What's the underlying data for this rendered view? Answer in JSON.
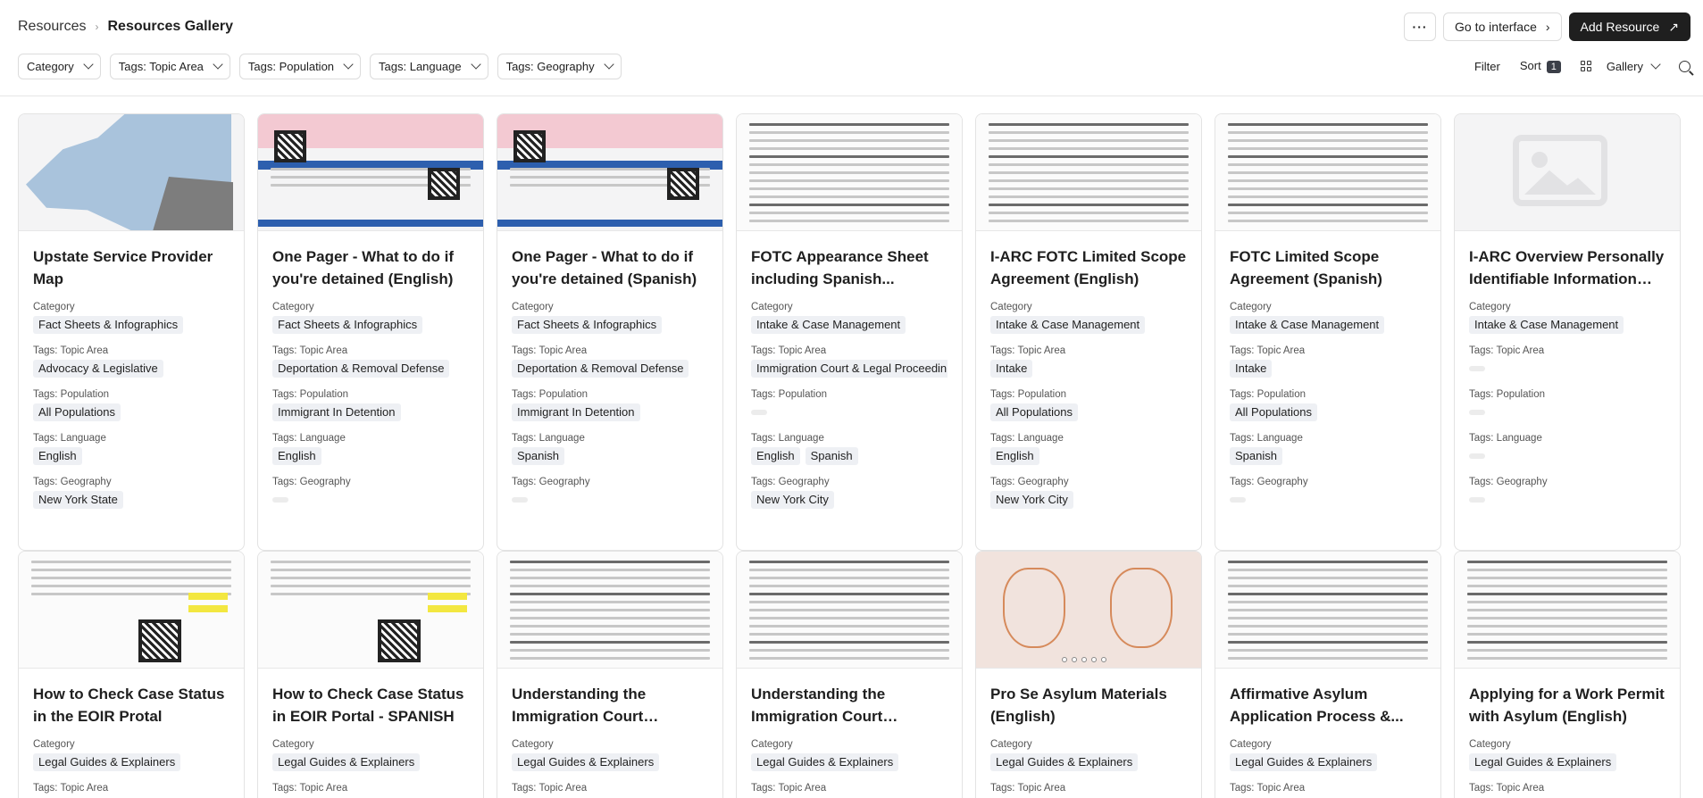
{
  "breadcrumb": {
    "root": "Resources",
    "current": "Resources Gallery"
  },
  "header": {
    "more_label": "···",
    "go_interface": "Go to interface",
    "add_resource": "Add Resource"
  },
  "filters": [
    "Category",
    "Tags: Topic Area",
    "Tags: Population",
    "Tags: Language",
    "Tags: Geography"
  ],
  "tools": {
    "filter": "Filter",
    "sort": "Sort",
    "sort_count": "1",
    "view": "Gallery"
  },
  "field_labels": {
    "category": "Category",
    "topic": "Tags: Topic Area",
    "population": "Tags: Population",
    "language": "Tags: Language",
    "geography": "Tags: Geography"
  },
  "cards_row1": [
    {
      "title": "Upstate Service Provider Map",
      "category": "Fact Sheets & Infographics",
      "topic": [
        "Advocacy & Legislative"
      ],
      "population": [
        "All Populations"
      ],
      "language": [
        "English"
      ],
      "geography": [
        "New York State"
      ]
    },
    {
      "title": "One Pager - What to do if you're detained (English)",
      "category": "Fact Sheets & Infographics",
      "topic": [
        "Deportation & Removal Defense"
      ],
      "population": [
        "Immigrant In Detention"
      ],
      "language": [
        "English"
      ],
      "geography": []
    },
    {
      "title": "One Pager - What to do if you're detained (Spanish)",
      "category": "Fact Sheets & Infographics",
      "topic": [
        "Deportation & Removal Defense"
      ],
      "population": [
        "Immigrant In Detention"
      ],
      "language": [
        "Spanish"
      ],
      "geography": []
    },
    {
      "title": "FOTC Appearance Sheet including Spanish...",
      "category": "Intake & Case Management",
      "topic": [
        "Immigration Court & Legal Proceedin"
      ],
      "population": [],
      "language": [
        "English",
        "Spanish"
      ],
      "geography": [
        "New York City"
      ]
    },
    {
      "title": "I-ARC FOTC Limited Scope Agreement (English)",
      "category": "Intake & Case Management",
      "topic": [
        "Intake"
      ],
      "population": [
        "All Populations"
      ],
      "language": [
        "English"
      ],
      "geography": [
        "New York City"
      ]
    },
    {
      "title": "FOTC Limited Scope Agreement (Spanish)",
      "category": "Intake & Case Management",
      "topic": [
        "Intake"
      ],
      "population": [
        "All Populations"
      ],
      "language": [
        "Spanish"
      ],
      "geography": []
    },
    {
      "title": "I-ARC Overview Personally Identifiable Information (PII)",
      "category": "Intake & Case Management",
      "topic": [],
      "population": [],
      "language": [],
      "geography": []
    }
  ],
  "cards_row2": [
    {
      "title": "How to Check Case Status in the EOIR Protal",
      "category": "Legal Guides & Explainers"
    },
    {
      "title": "How to Check Case Status in EOIR Portal - SPANISH",
      "category": "Legal Guides & Explainers"
    },
    {
      "title": "Understanding the Immigration Court Process...",
      "category": "Legal Guides & Explainers"
    },
    {
      "title": "Understanding the Immigration Court Process...",
      "category": "Legal Guides & Explainers"
    },
    {
      "title": "Pro Se Asylum Materials (English)",
      "category": "Legal Guides & Explainers"
    },
    {
      "title": "Affirmative Asylum Application Process &...",
      "category": "Legal Guides & Explainers"
    },
    {
      "title": "Applying for a Work Permit with Asylum (English)",
      "category": "Legal Guides & Explainers"
    }
  ]
}
